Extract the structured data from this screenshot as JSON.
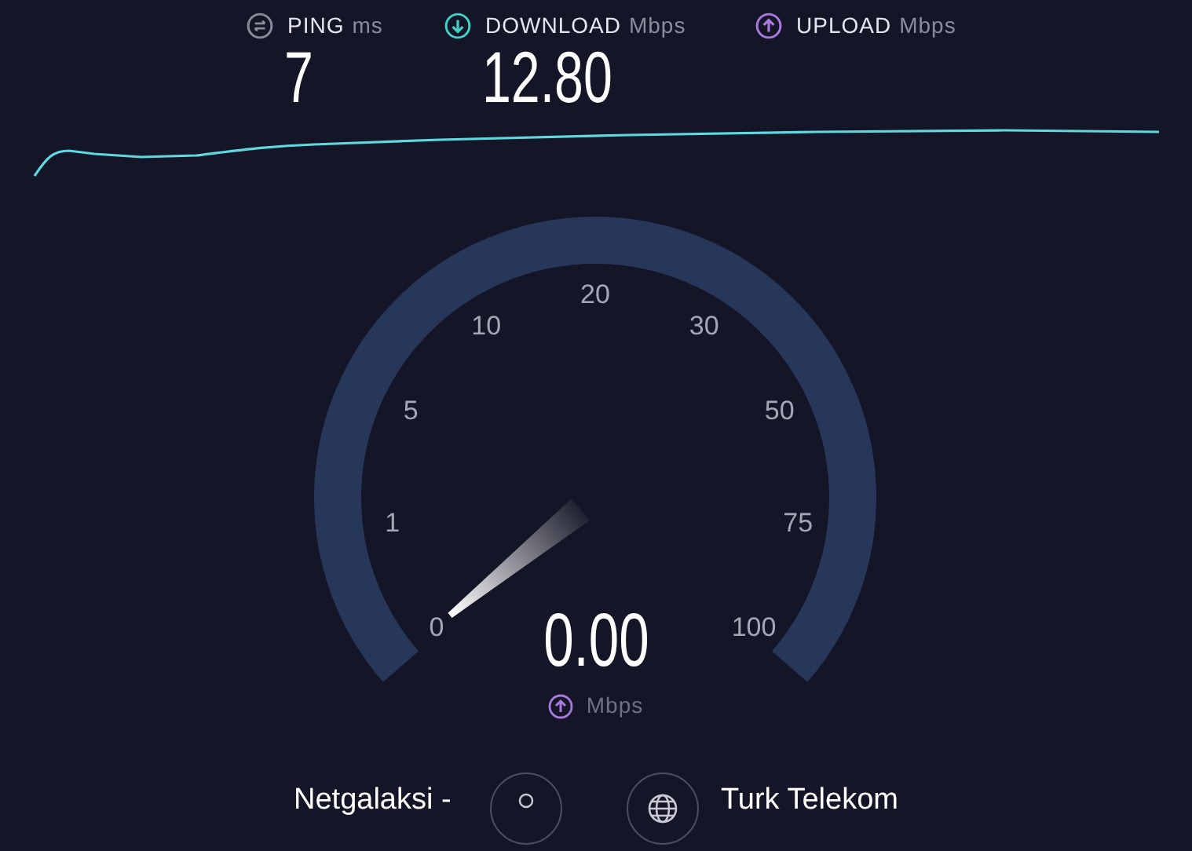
{
  "metrics": [
    {
      "kind": "ping",
      "label": "PING",
      "unit": "ms",
      "value": "7"
    },
    {
      "kind": "download",
      "label": "DOWNLOAD",
      "unit": "Mbps",
      "value": "12.80"
    },
    {
      "kind": "upload",
      "label": "UPLOAD",
      "unit": "Mbps"
    }
  ],
  "gauge": {
    "scale": [
      "0",
      "1",
      "5",
      "10",
      "20",
      "30",
      "50",
      "75",
      "100"
    ],
    "reading": "0.00",
    "unit": "Mbps",
    "kind": "upload"
  },
  "server": {
    "host": "Netgalaksi -",
    "isp": "Turk Telekom"
  }
}
